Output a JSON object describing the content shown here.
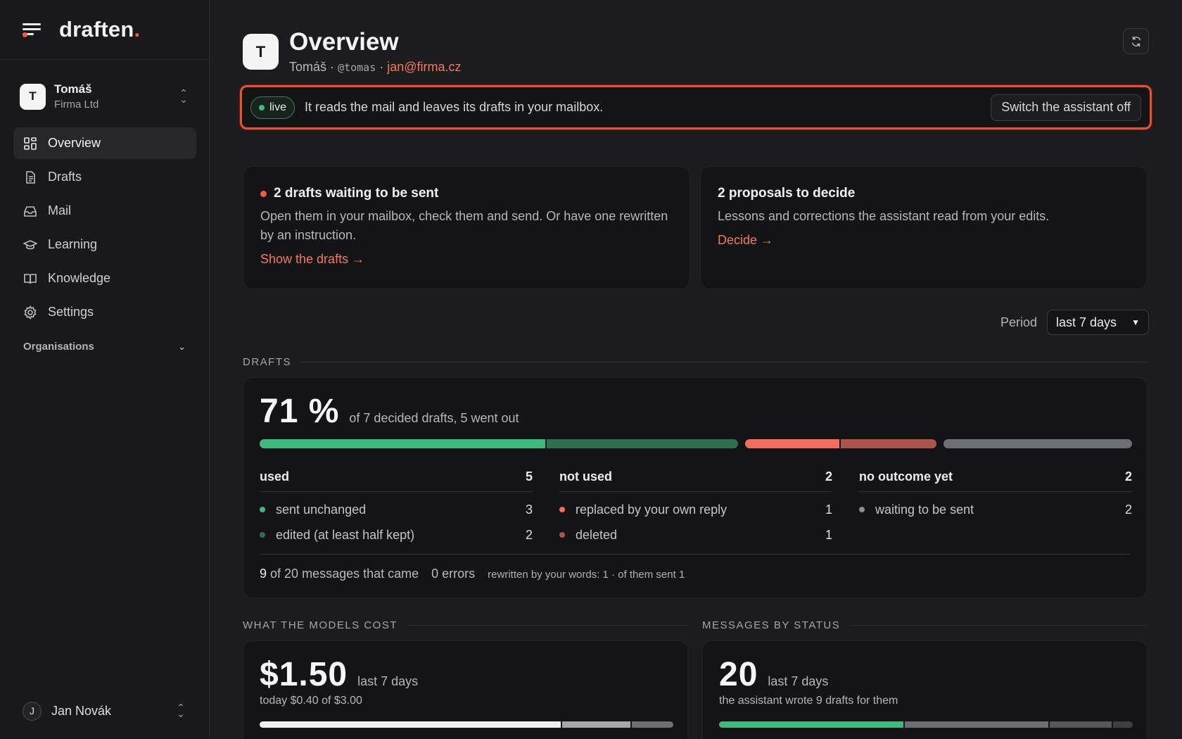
{
  "brand": {
    "name": "draften",
    "dot": "."
  },
  "org": {
    "initial": "T",
    "name": "Tomáš",
    "company": "Firma Ltd"
  },
  "nav": [
    {
      "label": "Overview",
      "icon": "grid-icon",
      "active": true
    },
    {
      "label": "Drafts",
      "icon": "document-icon"
    },
    {
      "label": "Mail",
      "icon": "inbox-icon"
    },
    {
      "label": "Learning",
      "icon": "graduation-cap-icon"
    },
    {
      "label": "Knowledge",
      "icon": "book-icon"
    },
    {
      "label": "Settings",
      "icon": "gear-icon"
    }
  ],
  "organisations_label": "Organisations",
  "user": {
    "initial": "J",
    "name": "Jan Novák"
  },
  "header": {
    "initial": "T",
    "title": "Overview",
    "name": "Tomáš",
    "sep": "·",
    "handle": "@tomas",
    "email": "jan@firma.cz"
  },
  "banner": {
    "status": "live",
    "text": "It reads the mail and leaves its drafts in your mailbox.",
    "button": "Switch the assistant off"
  },
  "cards": {
    "drafts_waiting": {
      "title": "2 drafts waiting to be sent",
      "text": "Open them in your mailbox, check them and send. Or have one rewritten by an instruction.",
      "link": "Show the drafts →"
    },
    "proposals": {
      "title": "2 proposals to decide",
      "text": "Lessons and corrections the assistant read from your edits.",
      "link": "Decide →"
    }
  },
  "period": {
    "label": "Period",
    "value": "last 7 days"
  },
  "drafts_section": {
    "label": "DRAFTS",
    "percent": "71 %",
    "note": "of 7 decided drafts, 5 went out",
    "bar": [
      {
        "name": "sent unchanged",
        "value": 3,
        "color": "#3fb97c"
      },
      {
        "name": "edited",
        "value": 2,
        "color": "#2f6e4e"
      },
      {
        "name": "replaced",
        "value": 1,
        "color": "#ef6e5e"
      },
      {
        "name": "deleted",
        "value": 1,
        "color": "#a9554c"
      },
      {
        "name": "waiting",
        "value": 2,
        "color": "#6e6e75"
      }
    ],
    "columns": [
      {
        "head": "used",
        "total": "5",
        "rows": [
          {
            "label": "sent unchanged",
            "value": "3",
            "color": "#3fb97c"
          },
          {
            "label": "edited (at least half kept)",
            "value": "2",
            "color": "#2f6e4e"
          }
        ]
      },
      {
        "head": "not used",
        "total": "2",
        "rows": [
          {
            "label": "replaced by your own reply",
            "value": "1",
            "color": "#ef6e5e"
          },
          {
            "label": "deleted",
            "value": "1",
            "color": "#a9554c"
          }
        ]
      },
      {
        "head": "no outcome yet",
        "total": "2",
        "rows": [
          {
            "label": "waiting to be sent",
            "value": "2",
            "color": "#8a8a90"
          }
        ]
      }
    ],
    "footer": {
      "count": "9",
      "of_messages": "of 20 messages that came",
      "errors": "0 errors",
      "rewritten": "rewritten by your words: 1 · of them sent 1"
    }
  },
  "cost_section": {
    "label": "WHAT THE MODELS COST",
    "value": "$1.50",
    "period": "last 7 days",
    "today": "today $0.40 of $3.00",
    "bar": [
      {
        "value": 0.73,
        "color": "#f0f0f2"
      },
      {
        "value": 0.17,
        "color": "#a8a8ac"
      },
      {
        "value": 0.1,
        "color": "#6e6e74"
      }
    ]
  },
  "status_section": {
    "label": "MESSAGES BY STATUS",
    "value": "20",
    "period": "last 7 days",
    "note": "the assistant wrote 9 drafts for them",
    "bar": [
      {
        "value": 9,
        "color": "#3fb97c"
      },
      {
        "value": 7,
        "color": "#6e6e75"
      },
      {
        "value": 3,
        "color": "#56565c"
      },
      {
        "value": 1,
        "color": "#3e3e43"
      }
    ]
  }
}
